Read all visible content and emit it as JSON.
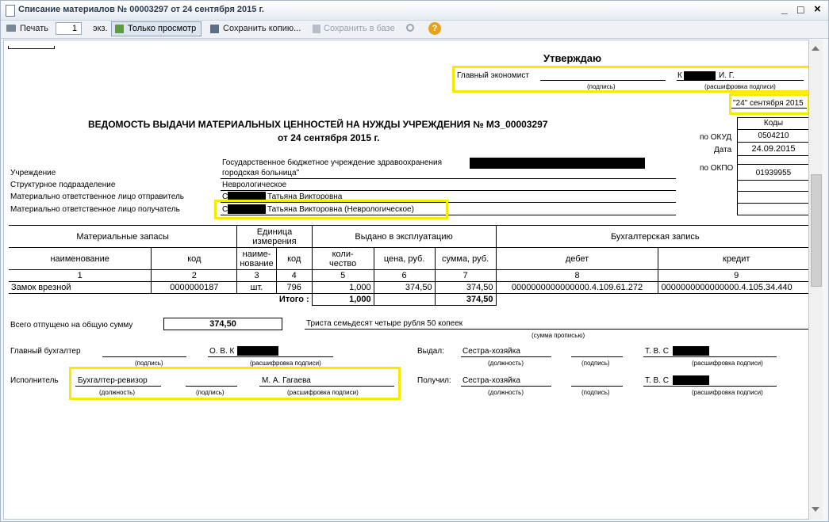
{
  "window": {
    "title": "Списание материалов № 00003297 от 24 сентября 2015 г.",
    "controls": [
      "_",
      "□",
      "×"
    ]
  },
  "toolbar": {
    "print_label": "Печать",
    "copies_value": "1",
    "copies_unit": "экз.",
    "view_only_label": "Только просмотр",
    "save_copy_label": "Сохранить копию...",
    "save_db_label": "Сохранить в базе",
    "help_label": "?"
  },
  "approve": {
    "title": "Утверждаю",
    "position": "Главный экономист",
    "name_prefix": "К",
    "name_suffix": "И. Г.",
    "sign_caption": "(подпись)",
    "decode_caption": "(расшифровка подписи)",
    "date": "\"24\" сентября 2015"
  },
  "header": {
    "title": "ВЕДОМОСТЬ ВЫДАЧИ МАТЕРИАЛЬНЫХ ЦЕННОСТЕЙ НА НУЖДЫ УЧРЕЖДЕНИЯ № МЗ_00003297",
    "subtitle": "от 24 сентября 2015 г."
  },
  "codes": {
    "caption": "Коды",
    "okud_label": "по ОКУД",
    "okud": "0504210",
    "date_label": "Дата",
    "date": "24.09.2015",
    "okpo_label": "по ОКПО",
    "okpo": "01939955"
  },
  "org": {
    "institution_label": "Учреждение",
    "institution_line1": "Государственное бюджетное учреждение здравоохранения",
    "institution_line2": "городская больница\"",
    "division_label": "Структурное подразделение",
    "division": "Неврологическое",
    "sender_label": "Материально ответственное лицо отправитель",
    "sender_prefix": "С",
    "sender": "Татьяна Викторовна",
    "receiver_label": "Материально ответственное лицо получатель",
    "receiver_prefix": "С",
    "receiver": "Татьяна Викторовна (Неврологическое)"
  },
  "table": {
    "h_materials": "Материальные запасы",
    "h_unit_1": "Единица",
    "h_unit_2": "измерения",
    "h_issued": "Выдано в эксплуатацию",
    "h_accounting": "Бухгалтерская запись",
    "h_name": "наименование",
    "h_code": "код",
    "h_unit_name_1": "наиме-",
    "h_unit_name_2": "нование",
    "h_unit_code": "код",
    "h_qty_1": "коли-",
    "h_qty_2": "чество",
    "h_price": "цена, руб.",
    "h_sum": "сумма, руб.",
    "h_debit": "дебет",
    "h_credit": "кредит",
    "nums": [
      "1",
      "2",
      "3",
      "4",
      "5",
      "6",
      "7",
      "8",
      "9"
    ],
    "row": {
      "name": "Замок врезной",
      "code": "0000000187",
      "unit": "шт.",
      "unit_code": "796",
      "qty": "1,000",
      "price": "374,50",
      "sum": "374,50",
      "debit": "0000000000000000.4.109.61.272",
      "credit": "0000000000000000.4.105.34.440"
    },
    "total_label": "Итого :",
    "total_qty": "1,000",
    "total_sum": "374,50"
  },
  "summary": {
    "label": "Всего отпущено на общую сумму",
    "amount": "374,50",
    "words": "Триста семьдесят четыре рубля 50 копеек",
    "words_caption": "(сумма прописью)"
  },
  "signatures": {
    "chief_label": "Главный бухгалтер",
    "chief_name": "О. В. К",
    "executor_label": "Исполнитель",
    "executor_position": "Бухгалтер-ревизор",
    "executor_name": "М. А. Гагаева",
    "issued_label": "Выдал:",
    "issued_position": "Сестра-хозяйка",
    "issued_name": "Т. В. С",
    "received_label": "Получил:",
    "received_position": "Сестра-хозяйка",
    "received_name": "Т. В. С",
    "cap_sign": "(подпись)",
    "cap_decode": "(расшифровка подписи)",
    "cap_position": "(должность)"
  }
}
